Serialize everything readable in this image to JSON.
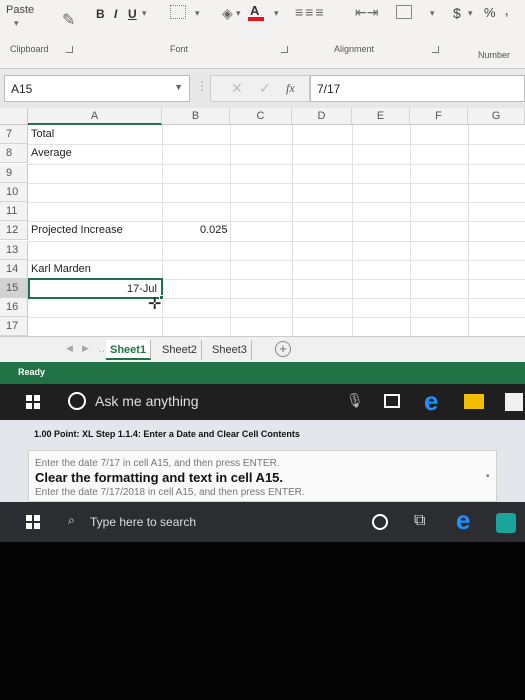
{
  "ribbon": {
    "paste_label": "Paste",
    "bold": "B",
    "italic": "I",
    "underline": "U",
    "currency": "$",
    "percent": "%",
    "groups": {
      "clipboard": "Clipboard",
      "font": "Font",
      "alignment": "Alignment",
      "number": "Number"
    }
  },
  "formula_bar": {
    "name_box": "A15",
    "fx_label": "fx",
    "formula": "7/17"
  },
  "grid": {
    "columns": [
      "A",
      "B",
      "C",
      "D",
      "E",
      "F",
      "G"
    ],
    "rows": [
      {
        "num": "7",
        "a": "Total",
        "b": ""
      },
      {
        "num": "8",
        "a": "Average",
        "b": ""
      },
      {
        "num": "9",
        "a": "",
        "b": ""
      },
      {
        "num": "10",
        "a": "",
        "b": ""
      },
      {
        "num": "11",
        "a": "",
        "b": ""
      },
      {
        "num": "12",
        "a": "Projected Increase",
        "b": "0.025"
      },
      {
        "num": "13",
        "a": "",
        "b": ""
      },
      {
        "num": "14",
        "a": "Karl Marden",
        "b": ""
      },
      {
        "num": "15",
        "a": "17-Jul",
        "b": ""
      },
      {
        "num": "16",
        "a": "",
        "b": ""
      },
      {
        "num": "17",
        "a": "",
        "b": ""
      }
    ]
  },
  "sheet_tabs": [
    "Sheet1",
    "Sheet2",
    "Sheet3"
  ],
  "status": "Ready",
  "taskbar_top": {
    "search_text": "Ask me anything"
  },
  "assignment": {
    "title": "1.00 Point: XL Step 1.1.4: Enter a Date and Clear Cell Contents",
    "line1": "Enter the date 7/17 in cell A15, and then press ENTER.",
    "line2": "Clear the formatting and text in cell A15.",
    "line3": "Enter the date 7/17/2018 in cell A15, and then press ENTER."
  },
  "taskbar_bottom": {
    "search_placeholder": "Type here to search"
  },
  "colors": {
    "excel_green": "#217346",
    "selection_border": "#1e7145"
  }
}
